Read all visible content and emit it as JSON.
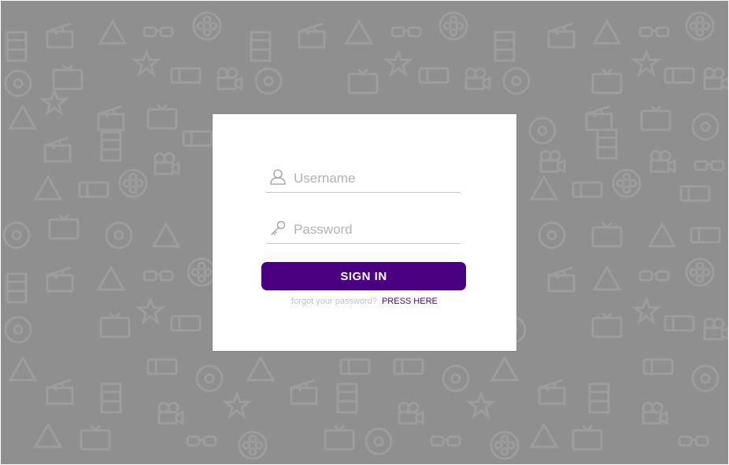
{
  "theme": {
    "background": "#8f8f8f",
    "card": "#ffffff",
    "accent": "#4b0082",
    "placeholder": "#b3b3b3",
    "muted_text": "#c2c2c2"
  },
  "background_pattern": {
    "icons": [
      "film-reel-icon",
      "clapperboard-icon",
      "movie-camera-icon",
      "film-strip-icon",
      "3d-glasses-icon",
      "ticket-icon",
      "popcorn-icon",
      "star-icon",
      "dvd-icon",
      "tv-icon"
    ]
  },
  "login": {
    "username": {
      "icon": "user-icon",
      "placeholder": "Username",
      "value": ""
    },
    "password": {
      "icon": "key-icon",
      "placeholder": "Password",
      "value": ""
    },
    "sign_in_label": "SIGN IN",
    "forgot_text": "forgot your password?",
    "press_here_label": "PRESS HERE"
  }
}
